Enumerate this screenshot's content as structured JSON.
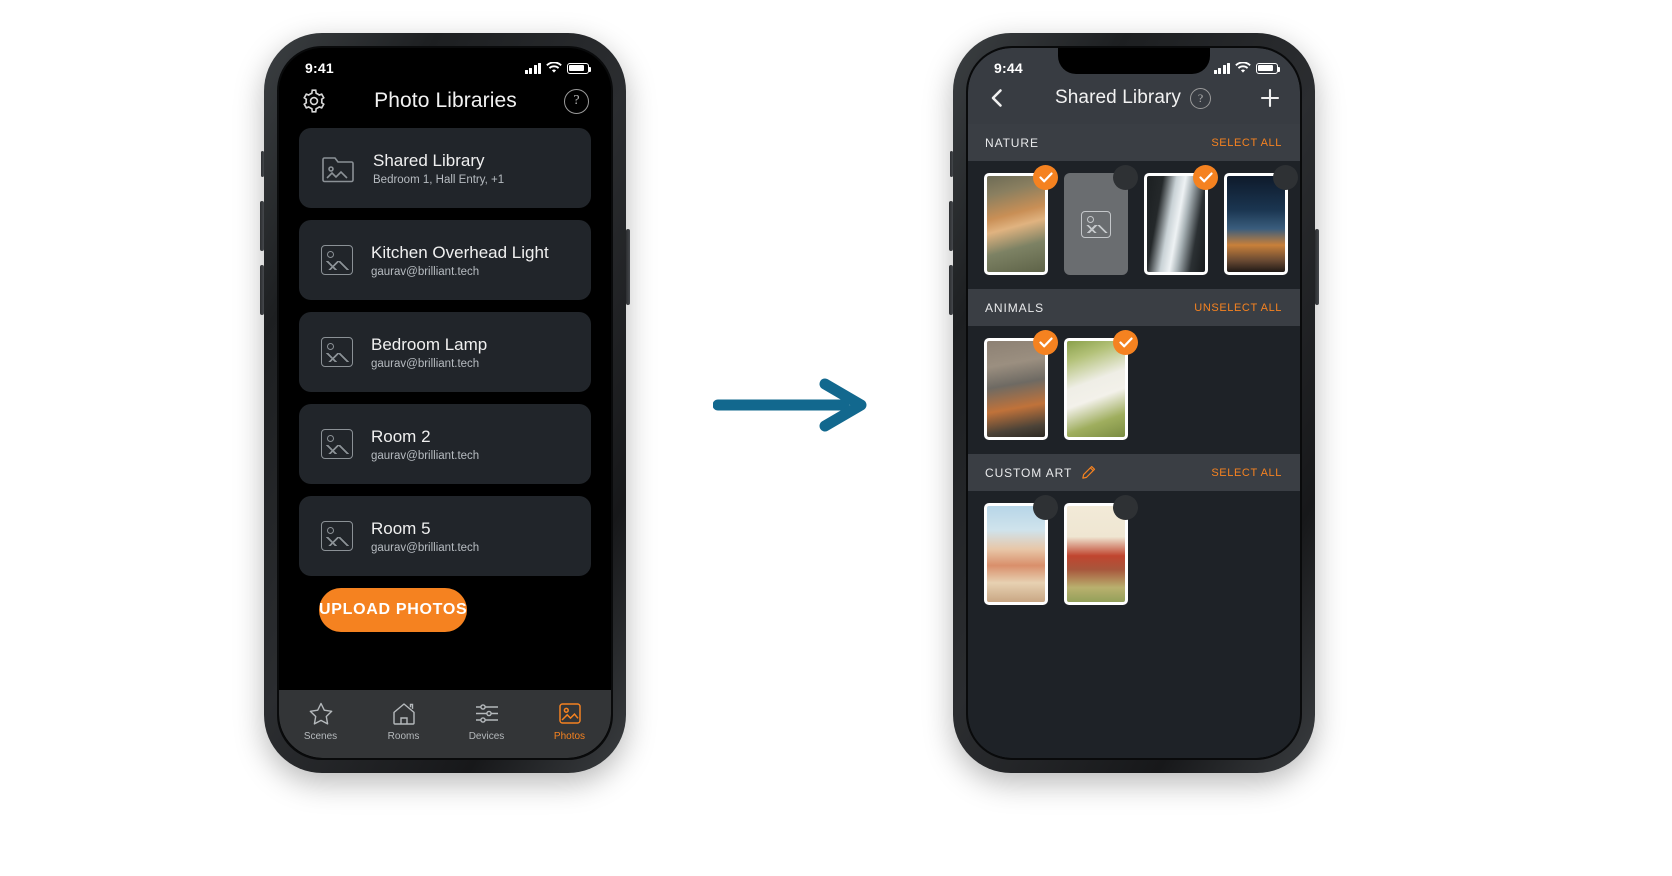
{
  "arrow": {
    "name": "right-arrow",
    "color": "#12688e"
  },
  "colors": {
    "accent": "#f58220",
    "screen_dark": "#000000",
    "panel": "#21252a",
    "right_bg": "#1e2227",
    "header_bg": "#3a3e44"
  },
  "left_phone": {
    "status": {
      "time": "9:41",
      "signal_icon": "cellular-bars-icon",
      "wifi_icon": "wifi-icon",
      "battery_icon": "battery-icon"
    },
    "nav": {
      "settings_icon": "gear-icon",
      "title": "Photo Libraries",
      "help_label": "?",
      "help_icon": "help-circle-icon"
    },
    "libraries": [
      {
        "title": "Shared Library",
        "subtitle": "Bedroom 1, Hall Entry, +1",
        "icon": "folder-image-icon"
      },
      {
        "title": "Kitchen Overhead Light",
        "subtitle": "gaurav@brilliant.tech",
        "icon": "image-placeholder-icon"
      },
      {
        "title": "Bedroom Lamp",
        "subtitle": "gaurav@brilliant.tech",
        "icon": "image-placeholder-icon"
      },
      {
        "title": "Room 2",
        "subtitle": "gaurav@brilliant.tech",
        "icon": "image-placeholder-icon"
      },
      {
        "title": "Room 5",
        "subtitle": "gaurav@brilliant.tech",
        "icon": "image-placeholder-icon"
      }
    ],
    "upload_button": "UPLOAD PHOTOS",
    "tabs": [
      {
        "label": "Scenes",
        "icon": "star-icon",
        "active": false
      },
      {
        "label": "Rooms",
        "icon": "home-icon",
        "active": false
      },
      {
        "label": "Devices",
        "icon": "sliders-icon",
        "active": false
      },
      {
        "label": "Photos",
        "icon": "photo-icon",
        "active": true
      }
    ]
  },
  "right_phone": {
    "status": {
      "time": "9:44",
      "signal_icon": "cellular-bars-icon",
      "wifi_icon": "wifi-icon",
      "battery_icon": "battery-icon"
    },
    "nav": {
      "back_icon": "chevron-left-icon",
      "title": "Shared Library",
      "help_label": "?",
      "help_icon": "help-circle-icon",
      "add_icon": "plus-icon"
    },
    "sections": [
      {
        "title": "NATURE",
        "action": "SELECT ALL",
        "edit_icon": null,
        "photos": [
          {
            "alt": "dog-in-backpack-photo",
            "selected": true,
            "empty": false
          },
          {
            "alt": "empty-photo-placeholder",
            "selected": false,
            "empty": true
          },
          {
            "alt": "waterfall-photo",
            "selected": true,
            "empty": false
          },
          {
            "alt": "city-skyline-photo",
            "selected": false,
            "empty": false
          }
        ]
      },
      {
        "title": "ANIMALS",
        "action": "UNSELECT ALL",
        "edit_icon": null,
        "photos": [
          {
            "alt": "bird-on-branch-photo",
            "selected": true,
            "empty": false
          },
          {
            "alt": "white-terrier-dog-photo",
            "selected": true,
            "empty": false
          }
        ]
      },
      {
        "title": "CUSTOM ART",
        "action": "SELECT ALL",
        "edit_icon": "pencil-icon",
        "photos": [
          {
            "alt": "kids-at-beach-photo",
            "selected": false,
            "empty": false
          },
          {
            "alt": "person-with-kite-photo",
            "selected": false,
            "empty": false
          }
        ]
      }
    ]
  }
}
